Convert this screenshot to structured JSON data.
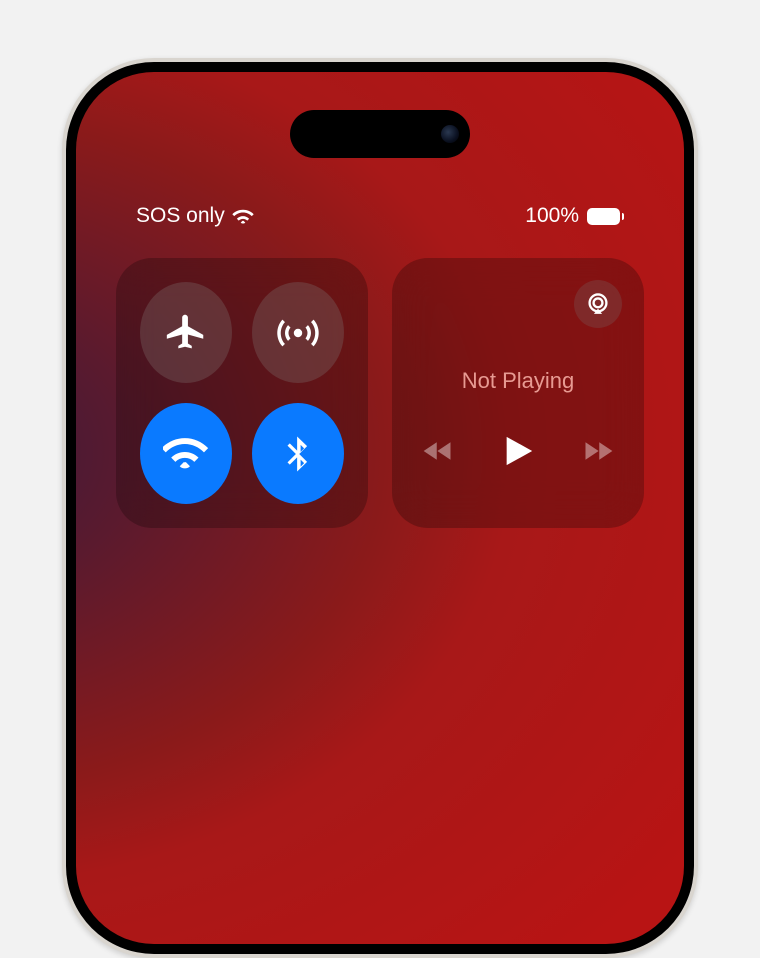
{
  "status": {
    "carrier": "SOS only",
    "battery_pct": "100%"
  },
  "connectivity": {
    "airplane_on": false,
    "cellular_on": false,
    "wifi_on": true,
    "bluetooth_on": true
  },
  "media": {
    "state": "Not Playing"
  },
  "colors": {
    "active_blue": "#0a7aff"
  }
}
